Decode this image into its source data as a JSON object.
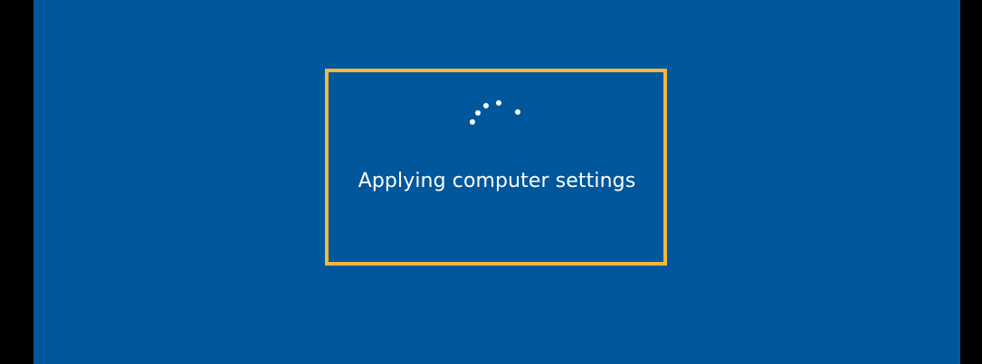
{
  "screen": {
    "status_text": "Applying computer settings",
    "background_color": "#01579b",
    "highlight_color": "#f3b73e",
    "spinner_icon": "loading-spinner-icon"
  }
}
